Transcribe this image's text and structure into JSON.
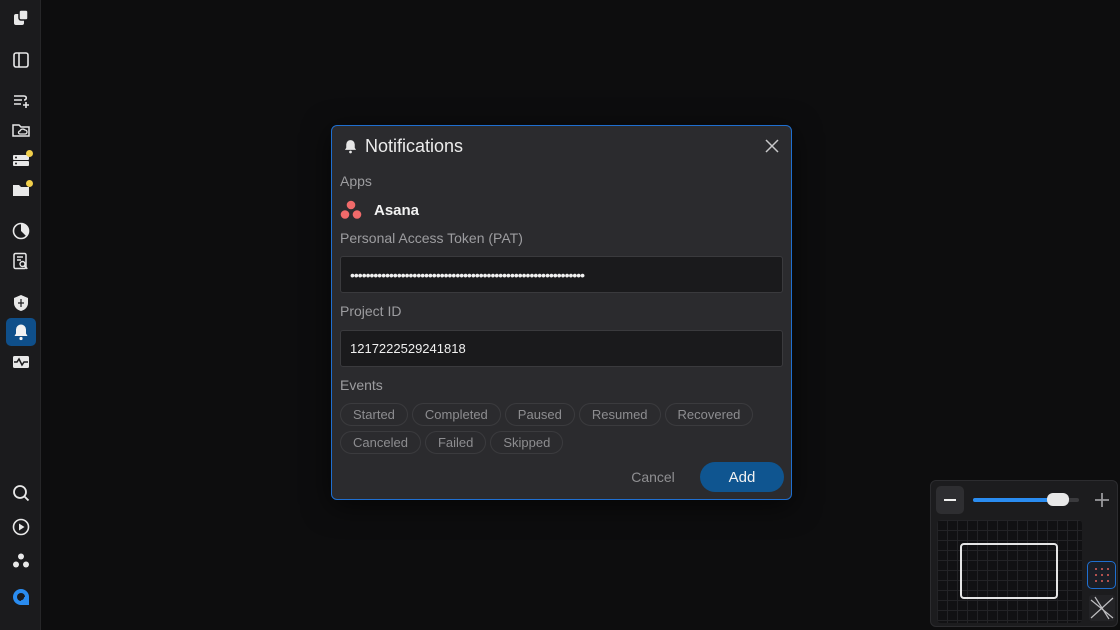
{
  "sidebar": {
    "items": [
      {
        "name": "logo",
        "icon": "logo-icon"
      },
      {
        "name": "panel",
        "icon": "sidebar-panel-icon"
      },
      {
        "name": "workflows",
        "icon": "workflow-add-icon"
      },
      {
        "name": "cloud-folder",
        "icon": "cloud-folder-icon"
      },
      {
        "name": "servers",
        "icon": "server-icon",
        "badge": true
      },
      {
        "name": "folders",
        "icon": "folder-icon",
        "badge": true
      },
      {
        "name": "analytics",
        "icon": "pie-chart-icon"
      },
      {
        "name": "reports",
        "icon": "document-search-icon"
      },
      {
        "name": "security",
        "icon": "shield-icon"
      },
      {
        "name": "notifications",
        "icon": "bell-icon",
        "active": true
      },
      {
        "name": "monitoring",
        "icon": "pulse-icon"
      },
      {
        "name": "search",
        "icon": "search-icon"
      },
      {
        "name": "run",
        "icon": "play-circle-icon"
      },
      {
        "name": "integrations",
        "icon": "asana-dots-icon"
      },
      {
        "name": "brand",
        "icon": "brand-logo-icon"
      }
    ],
    "badge_color": "#f2d04b",
    "active_color": "#0f4f8a"
  },
  "dialog": {
    "title": "Notifications",
    "apps_label": "Apps",
    "app_name": "Asana",
    "pat_label": "Personal Access Token (PAT)",
    "pat_value": "••••••••••••••••••••••••••••••••••••••••••••••••••••••••••••",
    "project_label": "Project ID",
    "project_value": "1217222529241818",
    "events_label": "Events",
    "events": [
      "Started",
      "Completed",
      "Paused",
      "Resumed",
      "Recovered",
      "Canceled",
      "Failed",
      "Skipped"
    ],
    "cancel_label": "Cancel",
    "add_label": "Add",
    "accent_color": "#1f6fd0",
    "add_color": "#0f5590"
  },
  "minimap": {
    "zoom_level": 0.88,
    "grid_active": true
  }
}
